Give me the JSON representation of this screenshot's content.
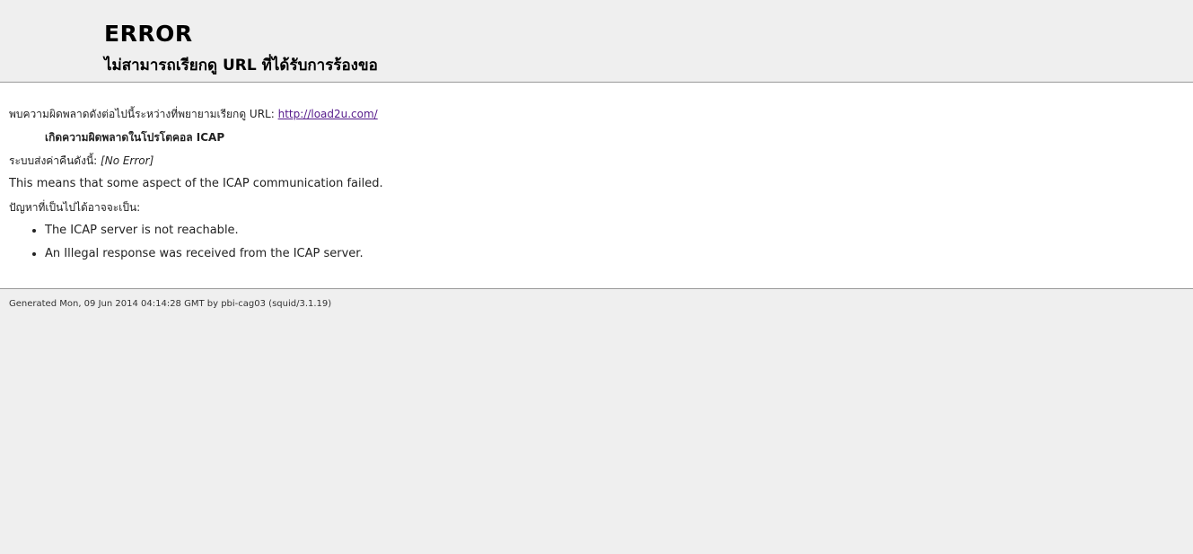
{
  "titles": {
    "heading": "ERROR",
    "subheading": "ไม่สามารถเรียกดู URL ที่ได้รับการร้องขอ"
  },
  "content": {
    "intro": "พบความผิดพลาดดังต่อไปนี้ระหว่างที่พยายามเรียกดู URL: ",
    "url": "http://load2u.com/",
    "error_title": "เกิดความผิดพลาดในโปรโตคอล ICAP",
    "system_reply_label": "ระบบส่งค่าคืนดังนี้: ",
    "system_reply_value": "[No Error]",
    "explanation": "This means that some aspect of the ICAP communication failed.",
    "causes_label": "ปัญหาที่เป็นไปได้อาจจะเป็น:",
    "causes": [
      "The ICAP server is not reachable.",
      "An Illegal response was received from the ICAP server."
    ]
  },
  "footer": {
    "generated": "Generated Mon, 09 Jun 2014 04:14:28 GMT by pbi-cag03 (squid/3.1.19)"
  }
}
